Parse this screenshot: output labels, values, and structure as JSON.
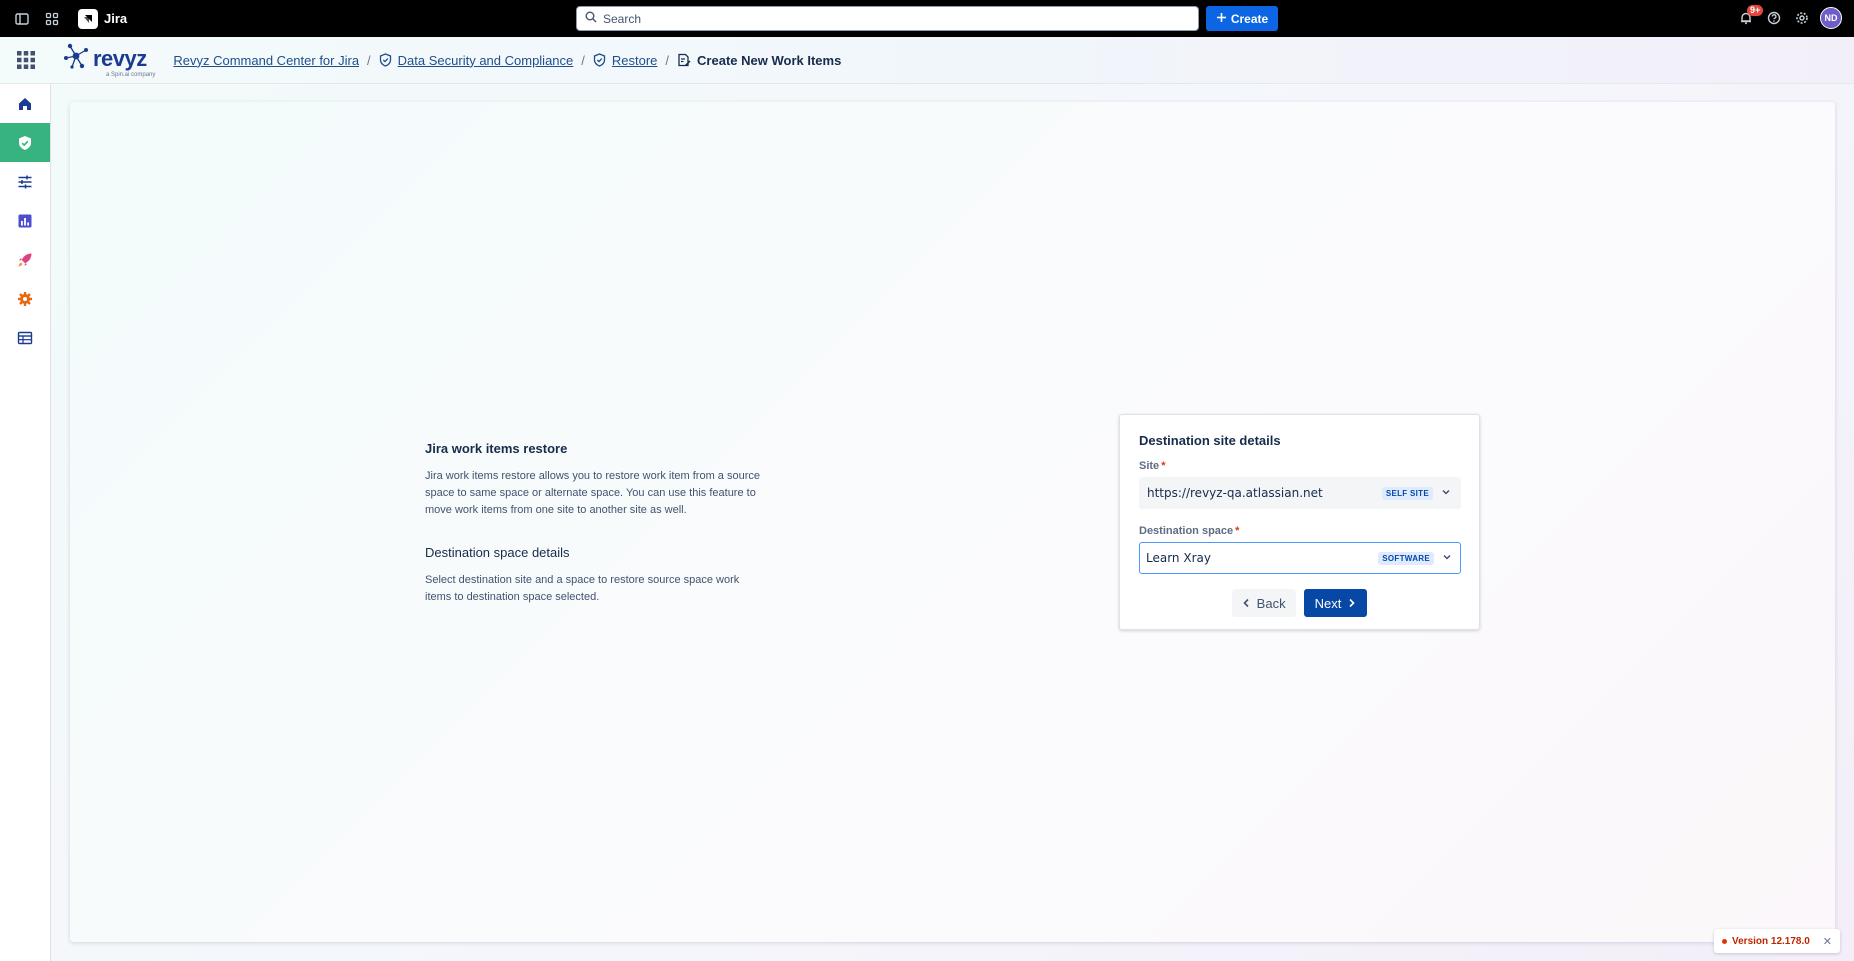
{
  "topbar": {
    "product": "Jira",
    "search_placeholder": "Search",
    "create_label": "Create",
    "notification_badge": "9+",
    "avatar_initials": "ND"
  },
  "app": {
    "logo_text": "revyz",
    "logo_subtext": "a Spin.ai company"
  },
  "breadcrumbs": {
    "items": [
      {
        "label": "Revyz Command Center for Jira"
      },
      {
        "label": "Data Security and Compliance"
      },
      {
        "label": "Restore"
      }
    ],
    "current": "Create New Work Items"
  },
  "sidebar": {
    "items": [
      {
        "name": "home-icon",
        "active": false
      },
      {
        "name": "shield-check-icon",
        "active": true
      },
      {
        "name": "sliders-icon",
        "active": false
      },
      {
        "name": "bar-chart-icon",
        "active": false
      },
      {
        "name": "rocket-icon",
        "active": false
      },
      {
        "name": "gear-icon",
        "active": false
      },
      {
        "name": "table-icon",
        "active": false
      }
    ]
  },
  "info": {
    "title": "Jira work items restore",
    "description": "Jira work items restore allows you to restore work item from a source space to same space or alternate space. You can use this feature to move work items from one site to another site as well.",
    "subtitle": "Destination space details",
    "subdescription": "Select destination site and a space to restore source space work items to destination space selected."
  },
  "form": {
    "title": "Destination site details",
    "site_label": "Site",
    "site_value": "https://revyz-qa.atlassian.net",
    "site_tag": "SELF SITE",
    "space_label": "Destination space",
    "space_value": "Learn Xray",
    "space_tag": "SOFTWARE",
    "back_label": "Back",
    "next_label": "Next"
  },
  "version": {
    "label": "Version 12.178.0"
  },
  "colors": {
    "topbar": "#000000",
    "create_button": "#0c66e4",
    "sidebar_active": "#36b37e",
    "next_button": "#0747a6",
    "version_text": "#bf2600"
  }
}
